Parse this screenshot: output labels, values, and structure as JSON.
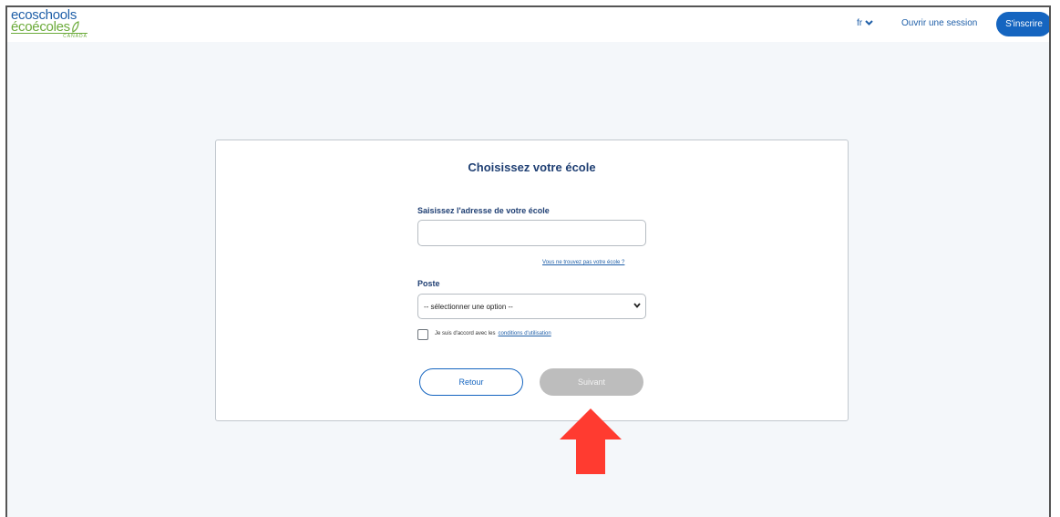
{
  "header": {
    "logo": {
      "line1": "ecoschools",
      "line2": "écoécoles",
      "line3": "CANADA"
    },
    "language": "fr",
    "login_label": "Ouvrir une session",
    "signup_label": "S'inscrire"
  },
  "form": {
    "title": "Choisissez votre école",
    "address_label": "Saisissez l'adresse de votre école",
    "address_value": "",
    "not_found_link": "Vous ne trouvez pas votre école ?",
    "role_label": "Poste",
    "role_selected": "-- sélectionner une option --",
    "agree_text": "Je suis d'accord avec les",
    "terms_link": "conditions d'utilisation",
    "back_label": "Retour",
    "next_label": "Suivant"
  },
  "colors": {
    "brand_blue": "#1565c0",
    "brand_green": "#6cab3b",
    "heading_navy": "#1f3f73",
    "disabled_gray": "#bdbdbd",
    "arrow_red": "#ff3b30",
    "page_background": "#f4f7fa"
  },
  "icons": {
    "language_dropdown": "chevron-down-icon",
    "select_dropdown": "chevron-down-icon",
    "logo_leaf": "leaf-icon",
    "annotation": "arrow-up-icon"
  }
}
